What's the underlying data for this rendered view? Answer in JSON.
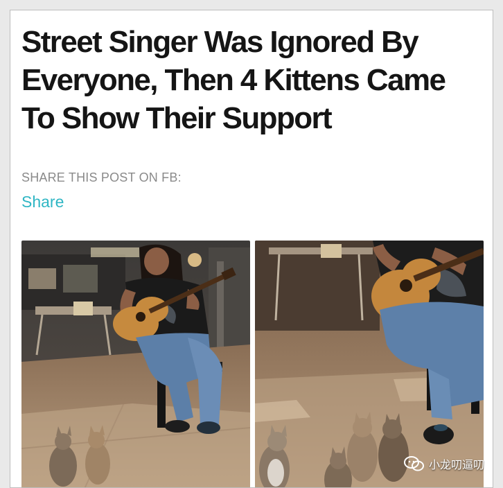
{
  "article": {
    "title": "Street Singer Was Ignored By Everyone, Then 4 Kittens Came To Show Their Support"
  },
  "share": {
    "label": "SHARE THIS POST ON FB:",
    "link_text": "Share"
  },
  "watermark": {
    "icon": "wechat-icon",
    "text": "小龙叨逼叨"
  },
  "colors": {
    "share_link": "#2fb6c4",
    "share_label": "#8a8a8a",
    "title": "#151515"
  }
}
